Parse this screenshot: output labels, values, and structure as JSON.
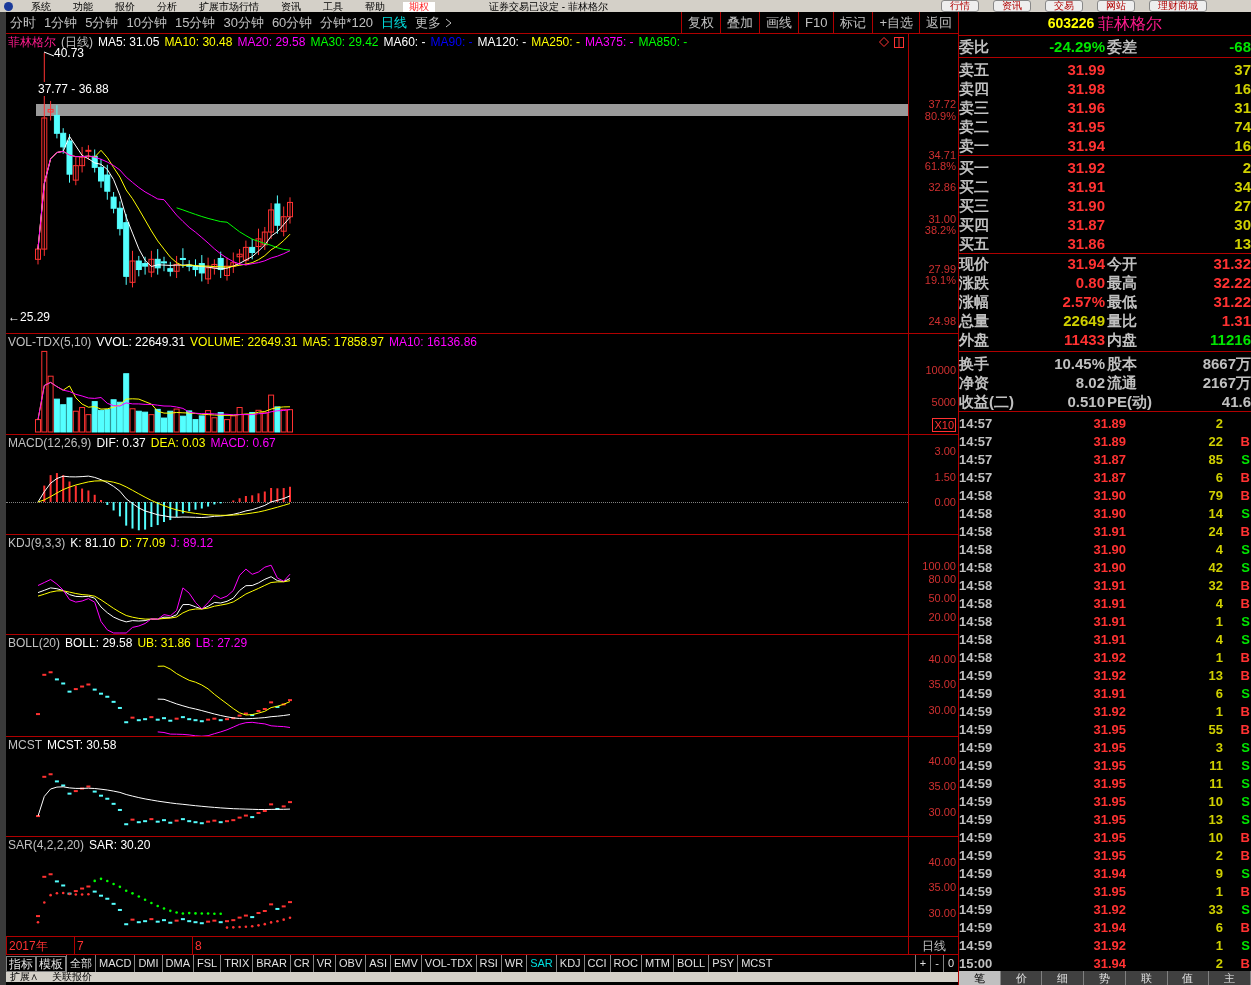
{
  "menu_bar": {
    "items": [
      {
        "label": "系统",
        "selected": false
      },
      {
        "label": "功能",
        "selected": false
      },
      {
        "label": "报价",
        "selected": false
      },
      {
        "label": "分析",
        "selected": false
      },
      {
        "label": "扩展市场行情",
        "selected": false
      },
      {
        "label": "资讯",
        "selected": false
      },
      {
        "label": "工具",
        "selected": false
      },
      {
        "label": "帮助",
        "selected": false
      },
      {
        "label": "期权",
        "selected": true
      }
    ],
    "title": "证券交易已设定 - 菲林格尔",
    "quick_buttons": [
      "行情",
      "资讯",
      "交易",
      "网站",
      "理财商城"
    ]
  },
  "period_tabs": [
    {
      "label": "分时",
      "selected": false
    },
    {
      "label": "1分钟",
      "selected": false
    },
    {
      "label": "5分钟",
      "selected": false
    },
    {
      "label": "10分钟",
      "selected": false
    },
    {
      "label": "15分钟",
      "selected": false
    },
    {
      "label": "30分钟",
      "selected": false
    },
    {
      "label": "60分钟",
      "selected": false
    },
    {
      "label": "分钟*120",
      "selected": false
    },
    {
      "label": "日线",
      "selected": true
    },
    {
      "label": "更多",
      "selected": false
    }
  ],
  "toolbar_buttons": [
    "复权",
    "叠加",
    "画线",
    "F10",
    "标记",
    "+自选",
    "返回"
  ],
  "panes": [
    {
      "kind": "kline",
      "header": [
        {
          "text": "菲林格尔",
          "color": "#ff1a8c"
        },
        {
          "text": "(日线)",
          "color": "#c0c0c0"
        },
        {
          "text": "MA5: 31.05",
          "color": "#ffffff"
        },
        {
          "text": "MA10: 30.48",
          "color": "#ffff00"
        },
        {
          "text": "MA20: 29.58",
          "color": "#ff00ff"
        },
        {
          "text": "MA30: 29.42",
          "color": "#00ff00"
        },
        {
          "text": "MA60: -",
          "color": "#ffffff"
        },
        {
          "text": "MA90: -",
          "color": "#0000ff"
        },
        {
          "text": "MA120: -",
          "color": "#ffffff"
        },
        {
          "text": "MA250: -",
          "color": "#ffff00"
        },
        {
          "text": "MA375: -",
          "color": "#ff00ff"
        },
        {
          "text": "MA850: -",
          "color": "#00ff00"
        }
      ],
      "ticks": [
        "37.72",
        "80.9%",
        "34.71",
        "61.8%",
        "32.86",
        "31.00",
        "38.2%",
        "27.99",
        "19.1%",
        "24.98"
      ],
      "annotations": [
        "40.73",
        "37.77 - 36.88",
        "←25.29"
      ]
    },
    {
      "kind": "volume",
      "header": [
        {
          "text": "VOL-TDX(5,10)",
          "color": "#c0c0c0"
        },
        {
          "text": "VVOL: 22649.31",
          "color": "#ffffff"
        },
        {
          "text": "VOLUME: 22649.31",
          "color": "#ffff00"
        },
        {
          "text": "MA5: 17858.97",
          "color": "#ffff00"
        },
        {
          "text": "MA10: 16136.86",
          "color": "#ff00ff"
        }
      ],
      "ticks": [
        "10000",
        "5000",
        "X10"
      ]
    },
    {
      "kind": "macd",
      "header": [
        {
          "text": "MACD(12,26,9)",
          "color": "#c0c0c0"
        },
        {
          "text": "DIF: 0.37",
          "color": "#ffffff"
        },
        {
          "text": "DEA: 0.03",
          "color": "#ffff00"
        },
        {
          "text": "MACD: 0.67",
          "color": "#ff00ff"
        }
      ],
      "ticks": [
        "3.00",
        "1.50",
        "0.00"
      ]
    },
    {
      "kind": "kdj",
      "header": [
        {
          "text": "KDJ(9,3,3)",
          "color": "#c0c0c0"
        },
        {
          "text": "K: 81.10",
          "color": "#ffffff"
        },
        {
          "text": "D: 77.09",
          "color": "#ffff00"
        },
        {
          "text": "J: 89.12",
          "color": "#ff00ff"
        }
      ],
      "ticks": [
        "100.00",
        "80.00",
        "50.00",
        "20.00"
      ]
    },
    {
      "kind": "boll",
      "header": [
        {
          "text": "BOLL(20)",
          "color": "#c0c0c0"
        },
        {
          "text": "BOLL: 29.58",
          "color": "#ffffff"
        },
        {
          "text": "UB: 31.86",
          "color": "#ffff00"
        },
        {
          "text": "LB: 27.29",
          "color": "#ff00ff"
        }
      ],
      "ticks": [
        "40.00",
        "35.00",
        "30.00"
      ]
    },
    {
      "kind": "mcst",
      "header": [
        {
          "text": "MCST",
          "color": "#c0c0c0"
        },
        {
          "text": "MCST: 30.58",
          "color": "#ffffff"
        }
      ],
      "ticks": [
        "40.00",
        "35.00",
        "30.00"
      ]
    },
    {
      "kind": "sar",
      "header": [
        {
          "text": "SAR(4,2,2,20)",
          "color": "#c0c0c0"
        },
        {
          "text": "SAR: 30.20",
          "color": "#ffffff"
        }
      ],
      "ticks": [
        "40.00",
        "35.00",
        "30.00"
      ]
    }
  ],
  "date_axis": {
    "labels": [
      "2017年",
      "7",
      "8"
    ],
    "period": "日线"
  },
  "indicator_tabs": {
    "fixed": [
      "指标",
      "模板"
    ],
    "items": [
      {
        "label": "全部",
        "selected": false
      },
      {
        "label": "MACD",
        "selected": false
      },
      {
        "label": "DMI",
        "selected": false
      },
      {
        "label": "DMA",
        "selected": false
      },
      {
        "label": "FSL",
        "selected": false
      },
      {
        "label": "TRIX",
        "selected": false
      },
      {
        "label": "BRAR",
        "selected": false
      },
      {
        "label": "CR",
        "selected": false
      },
      {
        "label": "VR",
        "selected": false
      },
      {
        "label": "OBV",
        "selected": false
      },
      {
        "label": "ASI",
        "selected": false
      },
      {
        "label": "EMV",
        "selected": false
      },
      {
        "label": "VOL-TDX",
        "selected": false
      },
      {
        "label": "RSI",
        "selected": false
      },
      {
        "label": "WR",
        "selected": false
      },
      {
        "label": "SAR",
        "selected": true
      },
      {
        "label": "KDJ",
        "selected": false
      },
      {
        "label": "CCI",
        "selected": false
      },
      {
        "label": "ROC",
        "selected": false
      },
      {
        "label": "MTM",
        "selected": false
      },
      {
        "label": "BOLL",
        "selected": false
      },
      {
        "label": "PSY",
        "selected": false
      },
      {
        "label": "MCST",
        "selected": false
      }
    ],
    "controls": [
      "+",
      "-",
      "0"
    ]
  },
  "bottom_links": [
    "扩展∧",
    "关联报价"
  ],
  "quote": {
    "code": "603226",
    "name": "菲林格尔",
    "ratio": {
      "label": "委比",
      "value": "-24.29%",
      "label2": "委差",
      "value2": "-68"
    },
    "asks": [
      {
        "label": "卖五",
        "price": "31.99",
        "volume": "37"
      },
      {
        "label": "卖四",
        "price": "31.98",
        "volume": "16"
      },
      {
        "label": "卖三",
        "price": "31.96",
        "volume": "31"
      },
      {
        "label": "卖二",
        "price": "31.95",
        "volume": "74"
      },
      {
        "label": "卖一",
        "price": "31.94",
        "volume": "16"
      }
    ],
    "bids": [
      {
        "label": "买一",
        "price": "31.92",
        "volume": "2"
      },
      {
        "label": "买二",
        "price": "31.91",
        "volume": "34"
      },
      {
        "label": "买三",
        "price": "31.90",
        "volume": "27"
      },
      {
        "label": "买四",
        "price": "31.87",
        "volume": "30"
      },
      {
        "label": "买五",
        "price": "31.86",
        "volume": "13"
      }
    ],
    "stats": [
      {
        "label": "现价",
        "value": "31.94",
        "color": "#ff3232"
      },
      {
        "label": "今开",
        "value": "31.32",
        "color": "#ff3232"
      },
      {
        "label": "涨跌",
        "value": "0.80",
        "color": "#ff3232"
      },
      {
        "label": "最高",
        "value": "32.22",
        "color": "#ff3232"
      },
      {
        "label": "涨幅",
        "value": "2.57%",
        "color": "#ff3232"
      },
      {
        "label": "最低",
        "value": "31.22",
        "color": "#ff3232"
      },
      {
        "label": "总量",
        "value": "22649",
        "color": "#d0d000"
      },
      {
        "label": "量比",
        "value": "1.31",
        "color": "#ff3232"
      },
      {
        "label": "外盘",
        "value": "11433",
        "color": "#ff3232"
      },
      {
        "label": "内盘",
        "value": "11216",
        "color": "#00e600"
      }
    ],
    "fundamentals": [
      {
        "label": "换手",
        "value": "10.45%",
        "label2": "股本",
        "value2": "8667万"
      },
      {
        "label": "净资",
        "value": "8.02",
        "label2": "流通",
        "value2": "2167万"
      },
      {
        "label": "收益(二)",
        "value": "0.510",
        "label2": "PE(动)",
        "value2": "41.6"
      }
    ],
    "ticks": [
      {
        "time": "14:57",
        "price": "31.89",
        "volume": "2",
        "kind": "none"
      },
      {
        "time": "14:57",
        "price": "31.89",
        "volume": "22",
        "flag": "B",
        "kind": "buy"
      },
      {
        "time": "14:57",
        "price": "31.87",
        "volume": "85",
        "flag": "S",
        "kind": "sell"
      },
      {
        "time": "14:57",
        "price": "31.87",
        "volume": "6",
        "flag": "B",
        "kind": "buy"
      },
      {
        "time": "14:58",
        "price": "31.90",
        "volume": "79",
        "flag": "B",
        "kind": "buy"
      },
      {
        "time": "14:58",
        "price": "31.90",
        "volume": "14",
        "flag": "S",
        "kind": "sell"
      },
      {
        "time": "14:58",
        "price": "31.91",
        "volume": "24",
        "flag": "B",
        "kind": "buy"
      },
      {
        "time": "14:58",
        "price": "31.90",
        "volume": "4",
        "flag": "S",
        "kind": "sell"
      },
      {
        "time": "14:58",
        "price": "31.90",
        "volume": "42",
        "flag": "S",
        "kind": "sell"
      },
      {
        "time": "14:58",
        "price": "31.91",
        "volume": "32",
        "flag": "B",
        "kind": "buy"
      },
      {
        "time": "14:58",
        "price": "31.91",
        "volume": "4",
        "flag": "B",
        "kind": "buy"
      },
      {
        "time": "14:58",
        "price": "31.91",
        "volume": "1",
        "flag": "S",
        "kind": "sell"
      },
      {
        "time": "14:58",
        "price": "31.91",
        "volume": "4",
        "flag": "S",
        "kind": "sell"
      },
      {
        "time": "14:58",
        "price": "31.92",
        "volume": "1",
        "flag": "B",
        "kind": "buy"
      },
      {
        "time": "14:59",
        "price": "31.92",
        "volume": "13",
        "flag": "B",
        "kind": "buy"
      },
      {
        "time": "14:59",
        "price": "31.91",
        "volume": "6",
        "flag": "S",
        "kind": "sell"
      },
      {
        "time": "14:59",
        "price": "31.92",
        "volume": "1",
        "flag": "B",
        "kind": "buy"
      },
      {
        "time": "14:59",
        "price": "31.95",
        "volume": "55",
        "flag": "B",
        "kind": "buy"
      },
      {
        "time": "14:59",
        "price": "31.95",
        "volume": "3",
        "flag": "S",
        "kind": "sell"
      },
      {
        "time": "14:59",
        "price": "31.95",
        "volume": "11",
        "flag": "S",
        "kind": "sell"
      },
      {
        "time": "14:59",
        "price": "31.95",
        "volume": "11",
        "flag": "S",
        "kind": "sell"
      },
      {
        "time": "14:59",
        "price": "31.95",
        "volume": "10",
        "flag": "S",
        "kind": "sell"
      },
      {
        "time": "14:59",
        "price": "31.95",
        "volume": "13",
        "flag": "S",
        "kind": "sell"
      },
      {
        "time": "14:59",
        "price": "31.95",
        "volume": "10",
        "flag": "B",
        "kind": "buy"
      },
      {
        "time": "14:59",
        "price": "31.95",
        "volume": "2",
        "flag": "B",
        "kind": "buy"
      },
      {
        "time": "14:59",
        "price": "31.94",
        "volume": "9",
        "flag": "S",
        "kind": "sell"
      },
      {
        "time": "14:59",
        "price": "31.95",
        "volume": "1",
        "flag": "B",
        "kind": "buy"
      },
      {
        "time": "14:59",
        "price": "31.92",
        "volume": "33",
        "flag": "S",
        "kind": "sell"
      },
      {
        "time": "14:59",
        "price": "31.94",
        "volume": "6",
        "flag": "B",
        "kind": "buy"
      },
      {
        "time": "14:59",
        "price": "31.92",
        "volume": "1",
        "flag": "S",
        "kind": "sell"
      },
      {
        "time": "15:00",
        "price": "31.94",
        "volume": "2",
        "flag": "B",
        "kind": "buy"
      }
    ],
    "detail_tabs": [
      {
        "label": "笔",
        "selected": true
      },
      {
        "label": "价",
        "selected": false
      },
      {
        "label": "细",
        "selected": false
      },
      {
        "label": "势",
        "selected": false
      },
      {
        "label": "联",
        "selected": false
      },
      {
        "label": "值",
        "selected": false
      },
      {
        "label": "主",
        "selected": false
      }
    ]
  }
}
